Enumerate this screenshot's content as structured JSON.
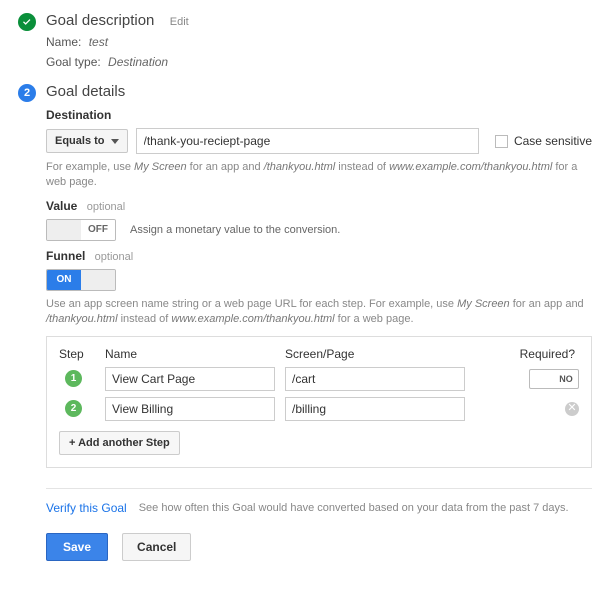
{
  "goal_description": {
    "title": "Goal description",
    "edit": "Edit",
    "name_label": "Name:",
    "name_value": "test",
    "type_label": "Goal type:",
    "type_value": "Destination"
  },
  "goal_details": {
    "step_number": "2",
    "title": "Goal details",
    "destination": {
      "heading": "Destination",
      "match_label": "Equals to",
      "url_value": "/thank-you-reciept-page",
      "case_label": "Case sensitive",
      "help_prefix": "For example, use ",
      "help_myscreen": "My Screen",
      "help_mid1": " for an app and ",
      "help_thankyou": "/thankyou.html",
      "help_mid2": " instead of ",
      "help_example": "www.example.com/thankyou.html",
      "help_suffix": " for a web page."
    },
    "value": {
      "heading": "Value",
      "optional": "optional",
      "state": "OFF",
      "desc": "Assign a monetary value to the conversion."
    },
    "funnel": {
      "heading": "Funnel",
      "optional": "optional",
      "state": "ON",
      "help_prefix": "Use an app screen name string or a web page URL for each step. For example, use ",
      "help_myscreen": "My Screen",
      "help_mid1": " for an app and ",
      "help_thankyou": "/thankyou.html",
      "help_mid2": " instead of ",
      "help_example": "www.example.com/thankyou.html",
      "help_suffix": " for a web page.",
      "cols": {
        "step": "Step",
        "name": "Name",
        "screen": "Screen/Page",
        "required": "Required?"
      },
      "rows": [
        {
          "num": "1",
          "name": "View Cart Page",
          "screen": "/cart",
          "required_label": "NO"
        },
        {
          "num": "2",
          "name": "View Billing",
          "screen": "/billing"
        }
      ],
      "add_label": "+ Add another Step"
    }
  },
  "verify": {
    "link": "Verify this Goal",
    "help": "See how often this Goal would have converted based on your data from the past 7 days."
  },
  "actions": {
    "save": "Save",
    "cancel": "Cancel"
  }
}
